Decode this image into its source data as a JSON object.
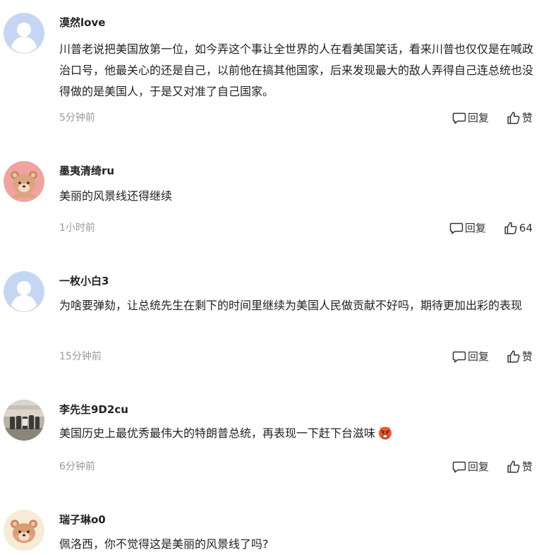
{
  "actions": {
    "reply_label": "回复",
    "like_label": "赞"
  },
  "comments": [
    {
      "username": "漠然love",
      "text": "川普老说把美国放第一位，如今弄这个事让全世界的人在看美国笑话，看来川普也仅仅是在喊政治口号，他最关心的还是自己，以前他在搞其他国家，后来发现最大的敌人弄得自己连总统也没得做的是美国人，于是又对准了自己国家。",
      "time": "5分钟前",
      "likes": "赞",
      "avatar_icon": "default-user-avatar"
    },
    {
      "username": "墨夷清绮ru",
      "text": "美丽的风景线还得继续",
      "time": "1小时前",
      "likes": "64",
      "avatar_icon": "bear-avatar-pink"
    },
    {
      "username": "一枚小白3",
      "text": "为啥要弹劾，让总统先生在剩下的时间里继续为美国人民做贡献不好吗，期待更加出彩的表现",
      "time": "15分钟前",
      "likes": "赞",
      "avatar_icon": "default-user-avatar"
    },
    {
      "username": "李先生9D2cu",
      "text": "美国历史上最优秀最伟大的特朗普总统，再表现一下赶下台滋味",
      "time": "6分钟前",
      "likes": "赞",
      "avatar_icon": "group-photo-avatar",
      "emoji": "angry-face-emoji"
    },
    {
      "username": "瑞子琳o0",
      "text": "佩洛西，你不觉得这是美丽的风景线了吗?",
      "time": "",
      "likes": "",
      "avatar_icon": "bear-avatar-cream"
    }
  ]
}
